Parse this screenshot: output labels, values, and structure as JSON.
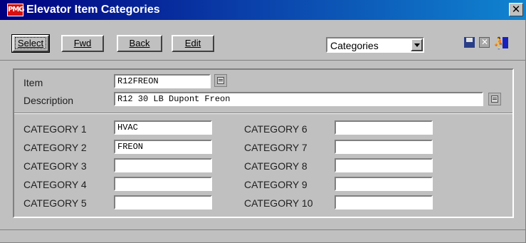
{
  "window": {
    "title": "Elevator Item Categories",
    "logo_text": "PMG"
  },
  "toolbar": {
    "select_label": "Select",
    "fwd_label": "Fwd",
    "back_label": "Back",
    "edit_label": "Edit",
    "view_dropdown": "Categories"
  },
  "item": {
    "label": "Item",
    "value": "R12FREON"
  },
  "description": {
    "label": "Description",
    "value": "R12 30 LB Dupont Freon"
  },
  "categories": [
    {
      "label": "CATEGORY 1",
      "value": "HVAC"
    },
    {
      "label": "CATEGORY 2",
      "value": "FREON"
    },
    {
      "label": "CATEGORY 3",
      "value": ""
    },
    {
      "label": "CATEGORY 4",
      "value": ""
    },
    {
      "label": "CATEGORY 5",
      "value": ""
    },
    {
      "label": "CATEGORY 6",
      "value": ""
    },
    {
      "label": "CATEGORY 7",
      "value": ""
    },
    {
      "label": "CATEGORY 8",
      "value": ""
    },
    {
      "label": "CATEGORY 9",
      "value": ""
    },
    {
      "label": "CATEGORY 10",
      "value": ""
    }
  ],
  "icons": {
    "save": "save-icon",
    "delete": "delete-icon",
    "exit": "exit-icon",
    "close": "close-icon",
    "lookup": "lookup-icon"
  },
  "colors": {
    "titlebar_start": "#000080",
    "titlebar_end": "#1084d0",
    "logo": "#d81010"
  }
}
